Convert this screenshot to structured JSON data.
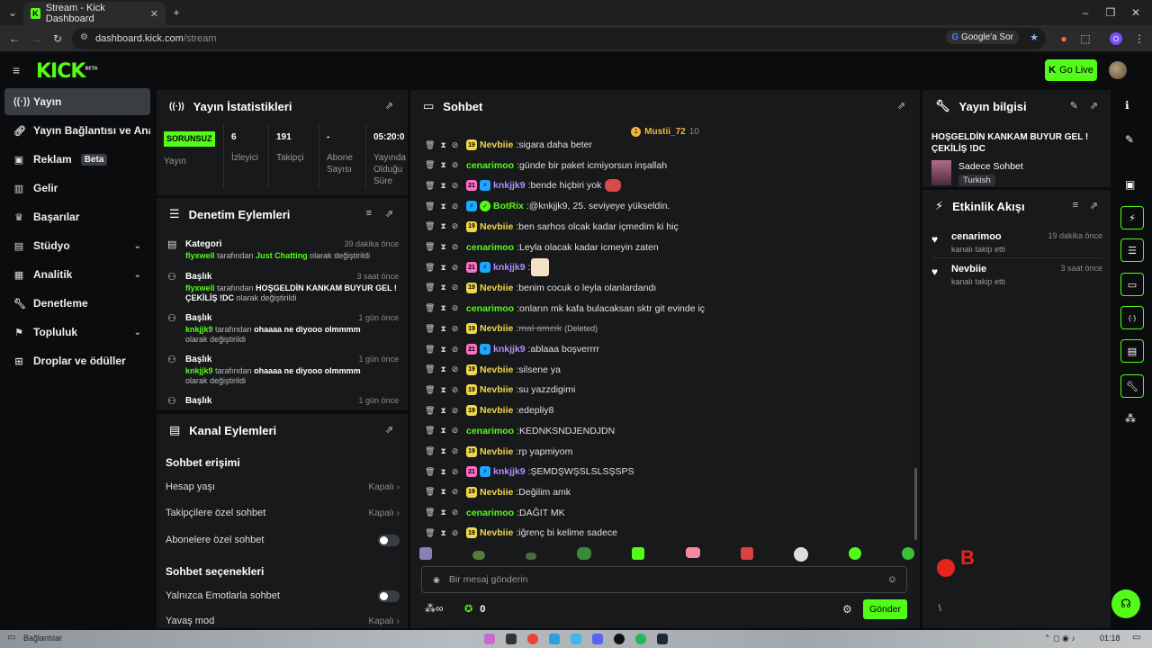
{
  "browser": {
    "tab_title": "Stream - Kick Dashboard",
    "url_host": "dashboard.kick.com",
    "url_path": "/stream",
    "google_lens_label": "Google'a Sor",
    "profile_letter": "O"
  },
  "header": {
    "logo": "KICK",
    "logo_sup": "BETA",
    "go_live": "Go Live"
  },
  "sidebar": {
    "items": [
      {
        "label": "Yayın"
      },
      {
        "label": "Yayın Bağlantısı ve Anahtarı"
      },
      {
        "label": "Reklam",
        "badge": "Beta"
      },
      {
        "label": "Gelir"
      },
      {
        "label": "Başarılar"
      },
      {
        "label": "Stüdyo"
      },
      {
        "label": "Analitik"
      },
      {
        "label": "Denetleme"
      },
      {
        "label": "Topluluk"
      },
      {
        "label": "Droplar ve ödüller"
      }
    ]
  },
  "stats": {
    "title": "Yayın İstatistikleri",
    "status": "SORUNSUZ",
    "status_label": "Yayın",
    "viewers": "6",
    "viewers_label": "İzleyici",
    "followers": "191",
    "followers_label": "Takipçi",
    "subs": "-",
    "subs_label": "Abone Sayısı",
    "uptime": "05:20:0",
    "uptime_label": "Yayında Olduğu Süre"
  },
  "moderation": {
    "title": "Denetim Eylemleri",
    "items": [
      {
        "title": "Kategori",
        "time": "39 dakika önce",
        "user": "flyxwell",
        "mid": " tarafından ",
        "value": "Just Chatting",
        "tail": " olarak değiştirildi"
      },
      {
        "title": "Başlık",
        "time": "3 saat önce",
        "user": "flyxwell",
        "mid": " tarafından ",
        "value": "HOŞGELDİN KANKAM BUYUR GEL ! ÇEKİLİŞ !DC",
        "tail": " olarak değiştirildi"
      },
      {
        "title": "Başlık",
        "time": "1 gün önce",
        "user": "knkjjk9",
        "mid": " tarafından ",
        "value": "ohaaaa ne diyooo olmmmm",
        "tail": " olarak değiştirildi"
      },
      {
        "title": "Başlık",
        "time": "1 gün önce",
        "user": "knkjjk9",
        "mid": " tarafından ",
        "value": "ohaaaa ne diyooo olmmmm",
        "tail": " olarak değiştirildi"
      },
      {
        "title": "Başlık",
        "time": "1 gün önce"
      }
    ]
  },
  "channel": {
    "title": "Kanal Eylemleri",
    "chat_access": "Sohbet erişimi",
    "account_age": "Hesap yaşı",
    "account_age_val": "Kapalı",
    "followers_only": "Takipçilere özel sohbet",
    "followers_only_val": "Kapalı",
    "subs_only": "Abonelere özel sohbet",
    "chat_options": "Sohbet seçenekleri",
    "emote_only": "Yalnızca Emotlarla sohbet",
    "slow_mode": "Yavaş mod",
    "slow_mode_val": "Kapalı"
  },
  "chat": {
    "title": "Sohbet",
    "pinned_user": "Mustii_72",
    "pinned_count": "10",
    "messages": [
      {
        "user": "Nevbiie",
        "color": "#f0d64a",
        "badges": [
          "sub"
        ],
        "text": "sigara daha beter"
      },
      {
        "user": "cenarimoo",
        "color": "#53fc18",
        "badges": [],
        "text": "günde bir paket icmiyorsun inşallah"
      },
      {
        "user": "knkjjk9",
        "color": "#b18cff",
        "badges": [
          "gift",
          "ver"
        ],
        "text": "bende hiçbiri yok",
        "emote": "red"
      },
      {
        "user": "BotRix",
        "color": "#53fc18",
        "badges": [
          "ver",
          "chk"
        ],
        "text": "@knkjjk9, 25. seviyeye yükseldin."
      },
      {
        "user": "Nevbiie",
        "color": "#f0d64a",
        "badges": [
          "sub"
        ],
        "text": "ben sarhos olcak kadar içmedim ki hiç"
      },
      {
        "user": "cenarimoo",
        "color": "#53fc18",
        "badges": [],
        "text": "Leyla olacak kadar icmeyin zaten"
      },
      {
        "user": "knkjjk9",
        "color": "#b18cff",
        "badges": [
          "gift",
          "ver"
        ],
        "text": "",
        "emote": "cream"
      },
      {
        "user": "Nevbiie",
        "color": "#f0d64a",
        "badges": [
          "sub"
        ],
        "text": "benim cocuk o leyla olanlardandı"
      },
      {
        "user": "cenarimoo",
        "color": "#53fc18",
        "badges": [],
        "text": "onların mk kafa bulacaksan sktr git evinde iç"
      },
      {
        "user": "Nevbiie",
        "color": "#f0d64a",
        "badges": [
          "sub"
        ],
        "text": "mal amcık",
        "deleted": "(Deleted)"
      },
      {
        "user": "knkjjk9",
        "color": "#b18cff",
        "badges": [
          "gift",
          "ver"
        ],
        "text": "ablaaa boşverrrr"
      },
      {
        "user": "Nevbiie",
        "color": "#f0d64a",
        "badges": [
          "sub"
        ],
        "text": "silsene ya"
      },
      {
        "user": "Nevbiie",
        "color": "#f0d64a",
        "badges": [
          "sub"
        ],
        "text": "su yazzdigimi"
      },
      {
        "user": "Nevbiie",
        "color": "#f0d64a",
        "badges": [
          "sub"
        ],
        "text": "edepliy8"
      },
      {
        "user": "cenarimoo",
        "color": "#53fc18",
        "badges": [],
        "text": "KEDNKSNDJENDJDN"
      },
      {
        "user": "Nevbiie",
        "color": "#f0d64a",
        "badges": [
          "sub"
        ],
        "text": "rp yapmiyom"
      },
      {
        "user": "knkjjk9",
        "color": "#b18cff",
        "badges": [
          "gift",
          "ver"
        ],
        "text": "ŞEMDŞWŞSLSLSŞSPS"
      },
      {
        "user": "Nevbiie",
        "color": "#f0d64a",
        "badges": [
          "sub"
        ],
        "text": "Değilim amk"
      },
      {
        "user": "cenarimoo",
        "color": "#53fc18",
        "badges": [],
        "text": "DAĞIT MK"
      },
      {
        "user": "Nevbiie",
        "color": "#f0d64a",
        "badges": [
          "sub"
        ],
        "text": "iğrenç bi kelime sadece"
      }
    ],
    "input_placeholder": "Bir mesaj gönderin",
    "points": "0",
    "send": "Gönder"
  },
  "stream_info": {
    "title": "Yayın bilgisi",
    "stream_title": "HOŞGELDİN KANKAM BUYUR GEL ! ÇEKİLİŞ !DC",
    "category": "Sadece Sohbet",
    "language": "Turkish"
  },
  "activity": {
    "title": "Etkinlik Akışı",
    "items": [
      {
        "name": "cenarimoo",
        "sub": "kanalı takip etti",
        "time": "19 dakika önce"
      },
      {
        "name": "Nevbiie",
        "sub": "kanalı takip etti",
        "time": "3 saat önce"
      }
    ]
  },
  "taskbar": {
    "left_label": "Bağlantılar",
    "clock": "01:18"
  }
}
